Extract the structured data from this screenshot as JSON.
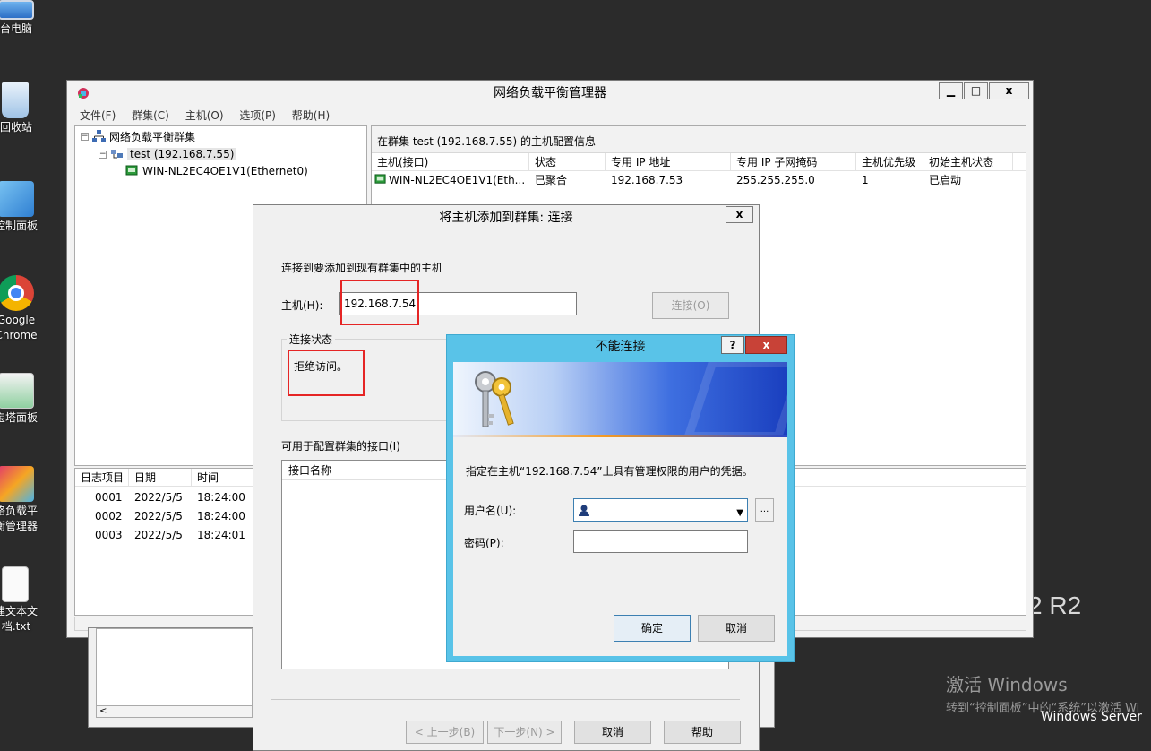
{
  "desktop": {
    "icons": [
      {
        "label": "台电脑",
        "icon": "computer-icon"
      },
      {
        "label": "回收站",
        "icon": "recycle-bin-icon"
      },
      {
        "label": "控制面板",
        "icon": "control-panel-icon"
      },
      {
        "label": "Google\nChrome",
        "icon": "chrome-icon"
      },
      {
        "label": "宝塔面板",
        "icon": "bt-panel-icon"
      },
      {
        "label": "络负载平\n衡管理器",
        "icon": "nlb-manager-icon"
      },
      {
        "label": "建文本文\n档.txt",
        "icon": "text-file-icon"
      }
    ],
    "watermark_r2": "2 R2",
    "activate_line1": "激活 Windows",
    "activate_line2": "转到“控制面板”中的“系统”以激活 Wi",
    "activate_line3": "Windows Server"
  },
  "main_window": {
    "title": "网络负载平衡管理器",
    "menu": [
      "文件(F)",
      "群集(C)",
      "主机(O)",
      "选项(P)",
      "帮助(H)"
    ],
    "tree": {
      "root": "网络负载平衡群集",
      "cluster": "test (192.168.7.55)",
      "host": "WIN-NL2EC4OE1V1(Ethernet0)"
    },
    "detail_header": "在群集 test (192.168.7.55) 的主机配置信息",
    "columns": [
      "主机(接口)",
      "状态",
      "专用 IP 地址",
      "专用 IP 子网掩码",
      "主机优先级",
      "初始主机状态"
    ],
    "rows": [
      [
        "WIN-NL2EC4OE1V1(Eth...",
        "已聚合",
        "192.168.7.53",
        "255.255.255.0",
        "1",
        "已启动"
      ]
    ],
    "log_columns": [
      "日志项目",
      "日期",
      "时间"
    ],
    "log_rows": [
      [
        "0001",
        "2022/5/5",
        "18:24:00"
      ],
      [
        "0002",
        "2022/5/5",
        "18:24:00"
      ],
      [
        "0003",
        "2022/5/5",
        "18:24:01"
      ]
    ]
  },
  "wizard": {
    "title": "将主机添加到群集: 连接",
    "instruction": "连接到要添加到现有群集中的主机",
    "host_label": "主机(H):",
    "host_value": "192.168.7.54",
    "connect_button": "连接(O)",
    "status_group_label": "连接状态",
    "status_text": "拒绝访问。",
    "interfaces_label": "可用于配置群集的接口(I)",
    "interfaces_header": "接口名称",
    "back_button": "< 上一步(B)",
    "next_button": "下一步(N) >",
    "cancel_button": "取消",
    "help_button": "帮助"
  },
  "cred_dialog": {
    "title": "不能连接",
    "help_glyph": "?",
    "close_glyph": "x",
    "message": "指定在主机“192.168.7.54”上具有管理权限的用户的凭据。",
    "username_label": "用户名(U):",
    "username_value": "",
    "browse_label": "...",
    "password_label": "密码(P):",
    "password_value": "",
    "ok_button": "确定",
    "cancel_button": "取消"
  },
  "colors": {
    "desktop_bg": "#2b2b2b",
    "cred_frame": "#59c3e8",
    "close_red": "#c84237",
    "highlight_red": "#e52525"
  }
}
